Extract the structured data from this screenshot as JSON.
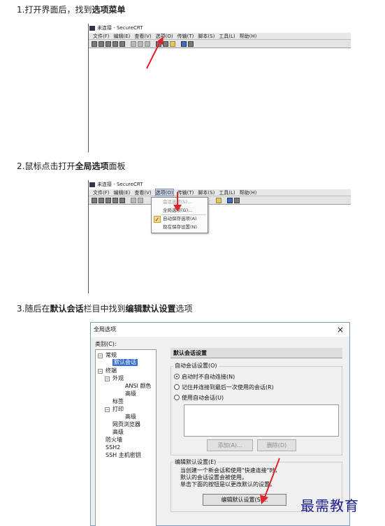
{
  "steps": [
    {
      "prefix": "1.打开界面后，找到",
      "bold": "选项菜单",
      "suffix": ""
    },
    {
      "prefix": "2.鼠标点击打开",
      "bold": "全局选项",
      "suffix": "面板"
    },
    {
      "prefix": "3.随后在",
      "bold": "默认会话",
      "suffix": "栏目中找到",
      "bold2": "编辑默认设置",
      "suffix2": "选项"
    }
  ],
  "crt": {
    "title": "未连接 - SecureCRT",
    "menu": [
      "文件(F)",
      "编辑(E)",
      "查看(V)",
      "选项(O)",
      "传输(T)",
      "脚本(S)",
      "工具(L)",
      "帮助(H)"
    ],
    "dropdown": [
      "会话选项(S)...",
      "全局选项(G)...",
      "自动保存选项(A)",
      "现在保存设置(N)"
    ]
  },
  "dialog": {
    "title": "全局选项",
    "close": "×",
    "category_label": "类别(C):",
    "tree": {
      "general": "常规",
      "default_session": "默认会话",
      "terminal": "终端",
      "appearance": "外观",
      "ansi_color": "ANSI 颜色",
      "advanced1": "高级",
      "tabs": "标签",
      "print": "打印",
      "advanced2": "高级",
      "web_browser": "网页浏览器",
      "advanced3": "高级",
      "firewall": "防火墙",
      "ssh2": "SSH2",
      "ssh_host_keys": "SSH 主机密钥"
    },
    "panel_title": "默认会话设置",
    "auto_session_group": "自动会话设置(O)",
    "radios": [
      "启动时不自动连接(N)",
      "记住并连接到最后一次使用的会话(R)",
      "使用自动会话(U)"
    ],
    "add_btn": "添加(A)...",
    "delete_btn": "删除(D)",
    "edit_group": "编辑默认设置(E)",
    "desc_lines": [
      "当创建一个新会话和使用\"快速连接\"时，",
      "默认的会话设置会被使用。",
      "单击下面的按钮是以更改默认的设置。"
    ],
    "edit_btn": "编辑默认设置(S)..."
  },
  "watermark": "最需教育"
}
